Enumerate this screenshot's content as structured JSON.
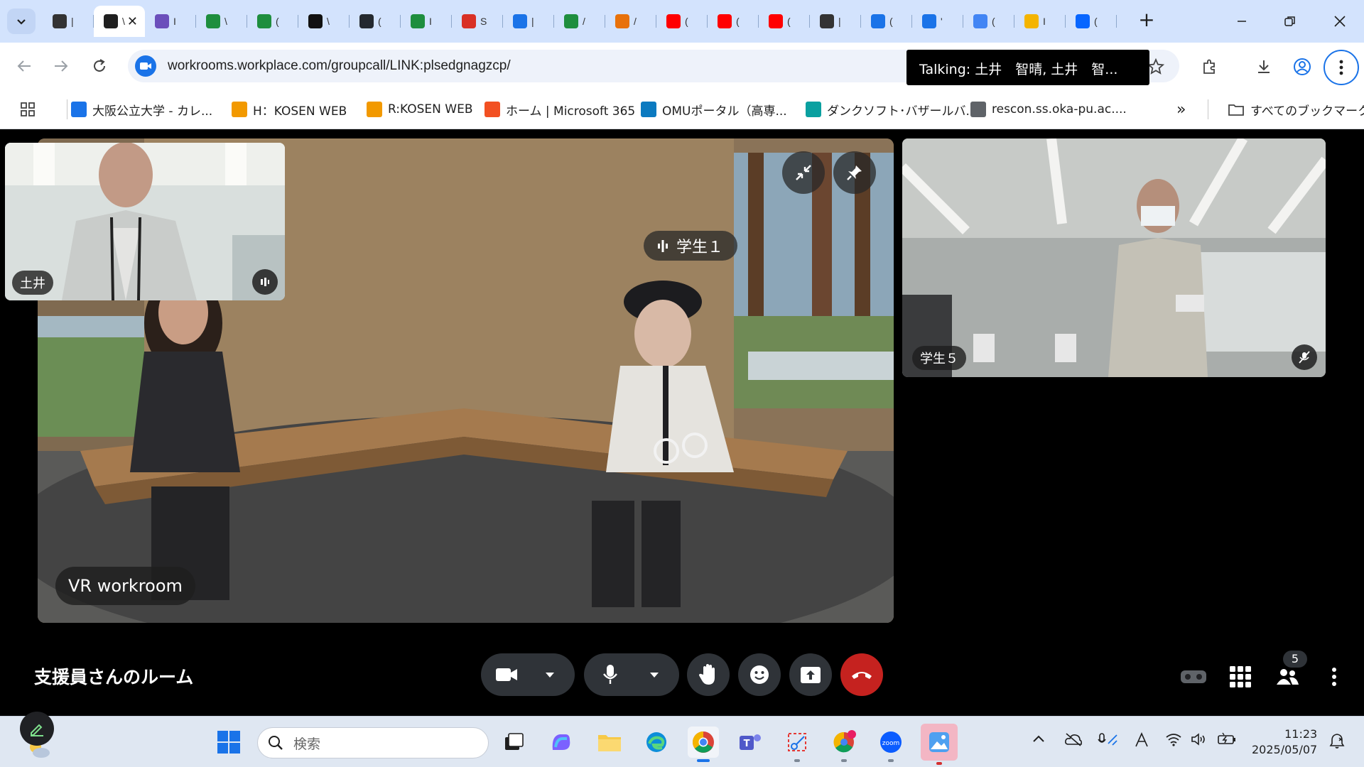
{
  "browser": {
    "tabs": [
      {
        "icon": "workrooms-tab-icon",
        "frag": "|",
        "color": "#333333"
      },
      {
        "icon": "workplace-tab-icon",
        "frag": "\\",
        "color": "#1f1f1f",
        "active": true
      },
      {
        "icon": "wiki-tab-icon",
        "frag": "I",
        "color": "#6b4fbb"
      },
      {
        "icon": "google-drive-icon",
        "frag": "\\",
        "color": "#1e8e3e"
      },
      {
        "icon": "google-drive-icon",
        "frag": "(",
        "color": "#1e8e3e"
      },
      {
        "icon": "w-icon",
        "frag": "\\",
        "color": "#111111"
      },
      {
        "icon": "github-icon",
        "frag": "(",
        "color": "#24292f"
      },
      {
        "icon": "google-drive-icon",
        "frag": "I",
        "color": "#1e8e3e"
      },
      {
        "icon": "record-icon",
        "frag": "S",
        "color": "#d93025"
      },
      {
        "icon": "tm-icon",
        "frag": "|",
        "color": "#1a73e8"
      },
      {
        "icon": "google-drive-icon",
        "frag": "/",
        "color": "#1e8e3e"
      },
      {
        "icon": "infinity-icon",
        "frag": "/",
        "color": "#e8710a"
      },
      {
        "icon": "youtube-icon",
        "frag": "(",
        "color": "#ff0000"
      },
      {
        "icon": "youtube-icon",
        "frag": "(",
        "color": "#ff0000"
      },
      {
        "icon": "youtube-icon",
        "frag": "(",
        "color": "#ff0000"
      },
      {
        "icon": "workrooms-tab-icon",
        "frag": "|",
        "color": "#333333"
      },
      {
        "icon": "gemini-icon",
        "frag": "(",
        "color": "#1a73e8"
      },
      {
        "icon": "tm-icon",
        "frag": "'",
        "color": "#1a73e8"
      },
      {
        "icon": "google-icon",
        "frag": "(",
        "color": "#4285f4"
      },
      {
        "icon": "pencil-tab-icon",
        "frag": "I",
        "color": "#f4b400"
      },
      {
        "icon": "meta-icon",
        "frag": "(",
        "color": "#0866ff"
      }
    ],
    "url": "workrooms.workplace.com/groupcall/LINK:plsedgnagzcp/",
    "tooltip": "Talking: 土井　智晴, 土井　智...",
    "bookmarks": [
      {
        "label": "大阪公立大学 - カレ...",
        "icon": "calendar-bookmark-icon",
        "color": "#1a73e8"
      },
      {
        "label": "H：KOSEN WEB",
        "icon": "people-bookmark-icon",
        "color": "#f29900"
      },
      {
        "label": "R:KOSEN WEB",
        "icon": "people-bookmark-icon",
        "color": "#f29900"
      },
      {
        "label": "ホーム | Microsoft 365",
        "icon": "microsoft-icon",
        "color": "#f25022"
      },
      {
        "label": "OMUポータル（高専...",
        "icon": "sharepoint-icon",
        "color": "#0b7ac0"
      },
      {
        "label": "ダンクソフト･バザールバ...",
        "icon": "bazaar-icon",
        "color": "#0aa0a0"
      },
      {
        "label": "rescon.ss.oka-pu.ac....",
        "icon": "globe-icon",
        "color": "#5f6368"
      }
    ],
    "all_bookmarks": "すべてのブックマーク"
  },
  "meeting": {
    "main_speaker": "学生１",
    "room_label": "VR workroom",
    "self_name": "土井",
    "right_name": "学生５",
    "room_name": "支援員さんのルーム",
    "participant_count": "5"
  },
  "taskbar": {
    "search_placeholder": "検索",
    "time": "11:23",
    "date": "2025/05/07"
  }
}
